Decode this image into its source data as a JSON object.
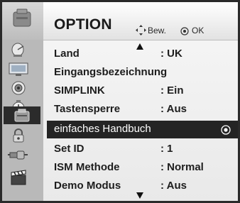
{
  "header": {
    "title": "OPTION",
    "move_hint": "Bew.",
    "ok_hint": "OK"
  },
  "sidebar": {
    "items": [
      {
        "icon": "tv-menu-icon"
      },
      {
        "icon": "satellite-dish-icon"
      },
      {
        "icon": "picture-icon"
      },
      {
        "icon": "audio-icon"
      },
      {
        "icon": "clock-icon"
      },
      {
        "icon": "option-icon"
      },
      {
        "icon": "lock-icon"
      },
      {
        "icon": "input-plug-icon"
      },
      {
        "icon": "media-clapper-icon"
      }
    ]
  },
  "menu": {
    "items": [
      {
        "label": "Land",
        "value": ": UK"
      },
      {
        "label": "Eingangsbezeichnung",
        "value": ""
      },
      {
        "label": "SIMPLINK",
        "value": ": Ein"
      },
      {
        "label": "Tastensperre",
        "value": ": Aus"
      },
      {
        "label": "einfaches Handbuch",
        "value": ""
      },
      {
        "label": "Set ID",
        "value": ": 1"
      },
      {
        "label": "ISM Methode",
        "value": ": Normal"
      },
      {
        "label": "Demo Modus",
        "value": ": Aus"
      }
    ],
    "selected_index": 4
  },
  "colors": {
    "selection": "#242424",
    "panel": "#f2f2f2",
    "sidebar": "#b9b9b9"
  }
}
